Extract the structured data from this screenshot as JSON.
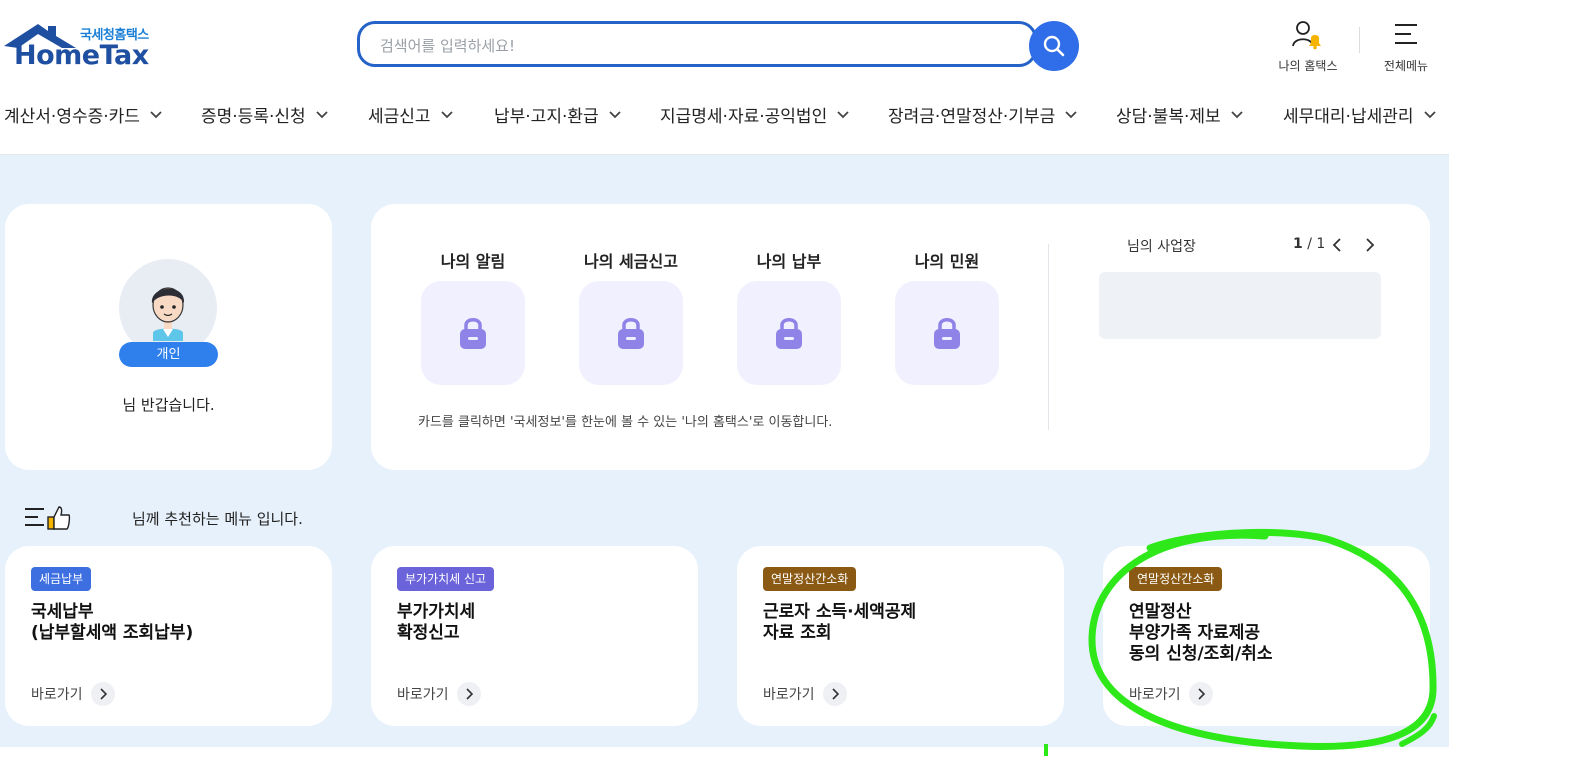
{
  "header": {
    "logo_sub": "국세청홈택스",
    "logo_main": "HomeTax",
    "search_placeholder": "검색어를 입력하세요!",
    "my_hometax": "나의 홈택스",
    "all_menu": "전체메뉴"
  },
  "nav": [
    {
      "label": "계산서·영수증·카드"
    },
    {
      "label": "증명·등록·신청"
    },
    {
      "label": "세금신고"
    },
    {
      "label": "납부·고지·환급"
    },
    {
      "label": "지급명세·자료·공익법인"
    },
    {
      "label": "장려금·연말정산·기부금"
    },
    {
      "label": "상담·불복·제보"
    },
    {
      "label": "세무대리·납세관리"
    }
  ],
  "profile": {
    "badge": "개인",
    "greeting": "님 반갑습니다."
  },
  "status": {
    "items": [
      {
        "label": "나의 알림"
      },
      {
        "label": "나의 세금신고"
      },
      {
        "label": "나의 납부"
      },
      {
        "label": "나의 민원"
      }
    ],
    "note": "카드를 클릭하면 '국세정보'를 한눈에 볼 수 있는 '나의 홈택스'로 이동합니다.",
    "biz_title": "님의 사업장",
    "page_current": "1",
    "page_total": "/ 1"
  },
  "recommend": {
    "title": "님께 추천하는 메뉴 입니다.",
    "cards": [
      {
        "tag": "세금납부",
        "tag_color": "#3d6fe0",
        "title": "국세납부\n(납부할세액 조회납부)",
        "go": "바로가기"
      },
      {
        "tag": "부가가치세 신고",
        "tag_color": "#6b63d9",
        "title": "부가가치세\n확정신고",
        "go": "바로가기"
      },
      {
        "tag": "연말정산간소화",
        "tag_color": "#8a5a14",
        "title": "근로자 소득·세액공제\n자료 조회",
        "go": "바로가기"
      },
      {
        "tag": "연말정산간소화",
        "tag_color": "#8a5a14",
        "title": "연말정산\n부양가족 자료제공\n동의 신청/조회/취소",
        "go": "바로가기"
      }
    ]
  },
  "colors": {
    "accent": "#2f6ee8",
    "band": "#e7f1fb",
    "annotation": "#2ee81a"
  }
}
